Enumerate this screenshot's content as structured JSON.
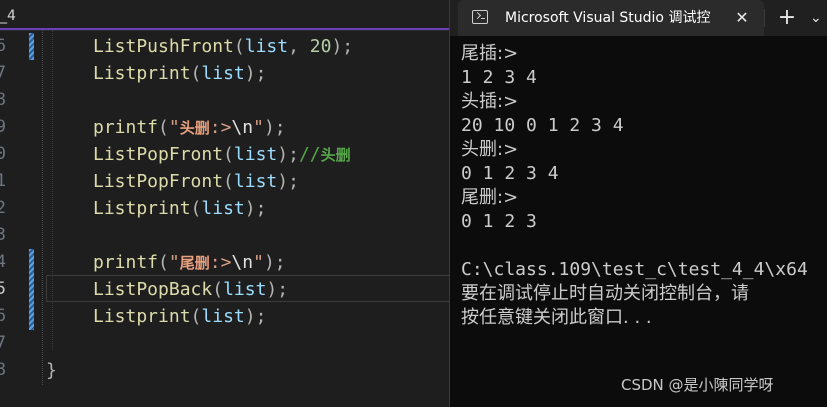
{
  "editor": {
    "tab_fragment": "_4",
    "line_numbers": [
      "6",
      "7",
      "8",
      "9",
      "0",
      "1",
      "2",
      "3",
      "4",
      "5",
      "6",
      "7",
      "8"
    ],
    "code": {
      "l1": {
        "fn": "ListPushFront",
        "open": "(",
        "arg1": "list",
        "comma": ", ",
        "num": "20",
        "close": ");"
      },
      "l2": {
        "fn": "Listprint",
        "open": "(",
        "arg1": "list",
        "close": ");"
      },
      "l4": {
        "fn": "printf",
        "open": "(",
        "q1": "\"",
        "cn": "头删",
        "tail": ":>",
        "esc": "\\n",
        "q2": "\"",
        "close": ");"
      },
      "l5": {
        "fn": "ListPopFront",
        "open": "(",
        "arg1": "list",
        "close": ");",
        "cmt": "//",
        "cmt_cn": "头删"
      },
      "l6": {
        "fn": "ListPopFront",
        "open": "(",
        "arg1": "list",
        "close": ");"
      },
      "l7": {
        "fn": "Listprint",
        "open": "(",
        "arg1": "list",
        "close": ");"
      },
      "l9": {
        "fn": "printf",
        "open": "(",
        "q1": "\"",
        "cn": "尾删",
        "tail": ":>",
        "esc": "\\n",
        "q2": "\"",
        "close": ");"
      },
      "l10": {
        "fn": "ListPopBack",
        "open": "(",
        "arg1": "list",
        "close": ");"
      },
      "l11": {
        "fn": "Listprint",
        "open": "(",
        "arg1": "list",
        "close": ");"
      },
      "brace": "}"
    }
  },
  "console": {
    "tab_title": "Microsoft Visual Studio 调试控",
    "close_glyph": "✕",
    "new_tab_glyph": "+",
    "dropdown_glyph": "⌄",
    "lines": [
      "尾插:>",
      "1 2 3 4",
      "头插:>",
      "20 10 0 1 2 3 4",
      "头删:>",
      "0 1 2 3 4",
      "尾删:>",
      "0 1 2 3",
      "",
      "C:\\class.109\\test_c\\test_4_4\\x64",
      "要在调试停止时自动关闭控制台，请",
      "按任意键关闭此窗口. . ."
    ],
    "watermark": "CSDN @是小陳同学呀"
  },
  "colors": {
    "editor_bg": "#1e1e1e",
    "console_bg": "#0c0c0c",
    "function": "#dcdcaa",
    "variable": "#9cdcfe",
    "string": "#d69d85",
    "comment": "#57a64a",
    "number": "#b5cea8",
    "accent": "#6a3fb8"
  }
}
